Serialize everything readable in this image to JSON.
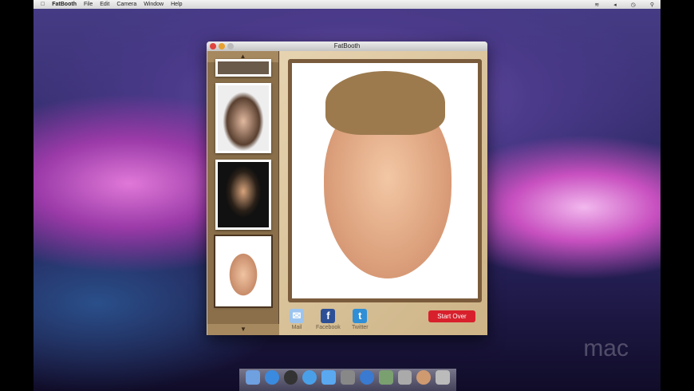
{
  "menubar": {
    "app": "FatBooth",
    "items": [
      "File",
      "Edit",
      "Camera",
      "Window",
      "Help"
    ],
    "apple_icon": "apple-icon",
    "status_icons": [
      "wifi-icon",
      "volume-icon",
      "clock-icon",
      "spotlight-icon"
    ]
  },
  "window": {
    "title": "FatBooth"
  },
  "sidebar": {
    "up_arrow": "▲",
    "down_arrow": "▼",
    "thumbnails": [
      "photo-1",
      "photo-2",
      "photo-3",
      "photo-4"
    ]
  },
  "share": [
    {
      "label": "Mail",
      "glyph": "✉",
      "color": "#9cc4ee"
    },
    {
      "label": "Facebook",
      "glyph": "f",
      "color": "#2d4f96"
    },
    {
      "label": "Twitter",
      "glyph": "t",
      "color": "#2f8fd6"
    }
  ],
  "start_over": "Start Over",
  "watermark": "mac",
  "dock": {
    "items": [
      "finder",
      "app-store",
      "dashboard",
      "safari",
      "ichat",
      "photo",
      "itunes",
      "iphoto",
      "expose",
      "fatbooth",
      "trash"
    ]
  }
}
